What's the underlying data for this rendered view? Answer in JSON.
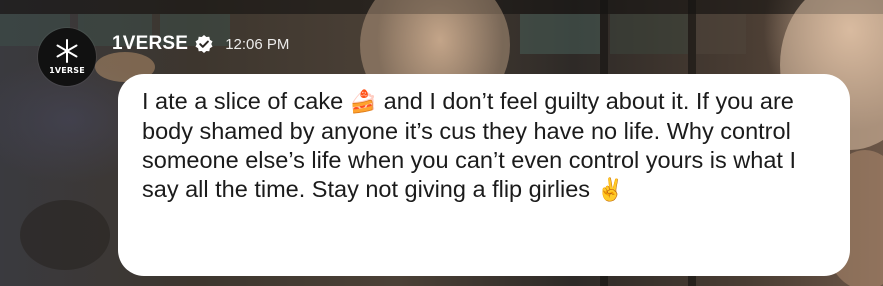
{
  "post": {
    "avatar": {
      "icon": "asterisk-logo-icon",
      "label": "1VERSE"
    },
    "username": "1VERSE",
    "verified_icon": "verified-badge-icon",
    "timestamp": "12:06 PM",
    "message": {
      "text_1": "I ate a slice of cake ",
      "emoji_1": "🍰",
      "text_2": " and I don’t feel guilty about it. If you are body shamed by anyone it’s cus they have no life. Why control someone else’s life when you can’t even control yours is what I say all the time. Stay not giving a flip girlies ",
      "emoji_2": "✌️"
    }
  },
  "colors": {
    "bubble": "#ffffff",
    "message_text": "#1b1b1b",
    "header_text": "#ffffff",
    "avatar_bg": "#111111"
  }
}
